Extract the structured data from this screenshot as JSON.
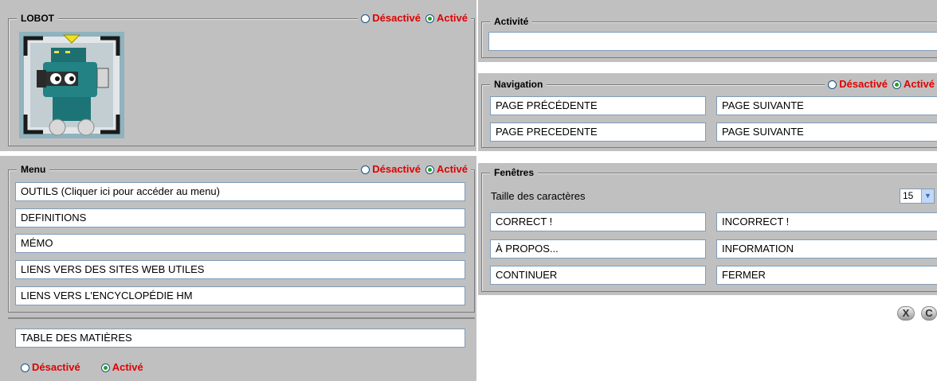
{
  "radio_labels": {
    "off": "Désactivé",
    "on": "Activé"
  },
  "lobot": {
    "title": "LOBOT",
    "state": "on"
  },
  "activity": {
    "title": "Activité",
    "value": ""
  },
  "navigation": {
    "title": "Navigation",
    "state": "on",
    "buttons": [
      "PAGE PRÉCÉDENTE",
      "PAGE SUIVANTE",
      "PAGE PRECEDENTE",
      "PAGE SUIVANTE"
    ]
  },
  "menu": {
    "title": "Menu",
    "state": "on",
    "items": [
      "OUTILS (Cliquer ici pour accéder au menu)",
      "DEFINITIONS",
      "MÉMO",
      "LIENS VERS DES SITES WEB UTILES",
      "LIENS VERS L'ENCYCLOPÉDIE HM"
    ]
  },
  "toc": {
    "label": "TABLE DES MATIÈRES",
    "state": "on"
  },
  "windows": {
    "title": "Fenêtres",
    "font_size_label": "Taille des caractères",
    "font_size_value": "15",
    "buttons": [
      "CORRECT !",
      "INCORRECT !",
      "À PROPOS...",
      "INFORMATION",
      "CONTINUER",
      "FERMER"
    ]
  },
  "corner_buttons": {
    "close": "X",
    "other": "C"
  },
  "icons": [
    "robot-icon",
    "radio-icon",
    "chevron-down-icon",
    "close-icon"
  ],
  "colors": {
    "panel": "#c0c0c0",
    "radio_label": "#e00000",
    "radio_selected": "#21a121",
    "field_border": "#7f9db9"
  }
}
